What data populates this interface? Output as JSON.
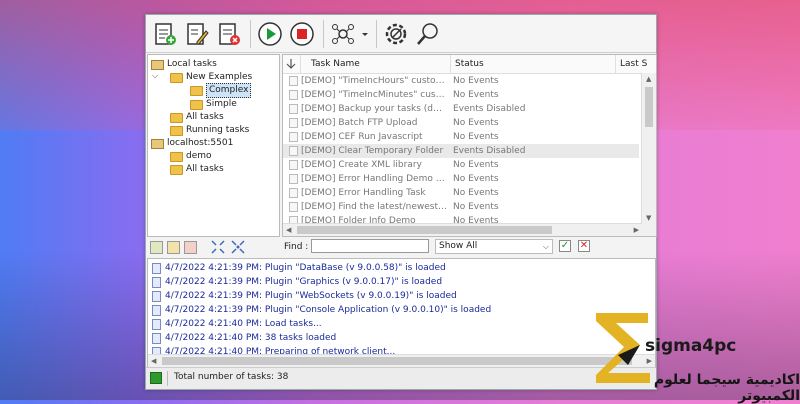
{
  "colors": {
    "accent": "#e3b324",
    "status_ok": "#2e9a2e",
    "log_text": "#1a2a9a"
  },
  "toolbar": {
    "buttons": [
      {
        "icon": "new-task-icon"
      },
      {
        "icon": "edit-task-icon"
      },
      {
        "icon": "delete-task-icon"
      },
      {
        "icon": "run-icon"
      },
      {
        "icon": "stop-icon"
      },
      {
        "icon": "network-icon"
      },
      {
        "icon": "settings-icon"
      },
      {
        "icon": "search-icon"
      }
    ]
  },
  "tree": {
    "items": [
      {
        "label": "Local tasks",
        "icon": "server-icon"
      },
      {
        "label": "New Examples",
        "icon": "folder-icon"
      },
      {
        "label": "Complex",
        "icon": "folder-icon",
        "selected": true
      },
      {
        "label": "Simple",
        "icon": "folder-icon"
      },
      {
        "label": "All tasks",
        "icon": "folder-icon"
      },
      {
        "label": "Running tasks",
        "icon": "folder-icon"
      },
      {
        "label": "localhost:5501",
        "icon": "server-icon"
      },
      {
        "label": "demo",
        "icon": "folder-icon"
      },
      {
        "label": "All tasks",
        "icon": "folder-icon"
      }
    ]
  },
  "grid": {
    "columns": [
      "Task Name",
      "Status",
      "Last S"
    ],
    "rows": [
      {
        "name": "[DEMO] \"TimeIncHours\" custom f...",
        "status": "No Events"
      },
      {
        "name": "[DEMO] \"TimeIncMinutes\" custom ...",
        "status": "No Events"
      },
      {
        "name": "[DEMO] Backup your tasks (daily ...",
        "status": "Events Disabled"
      },
      {
        "name": "[DEMO] Batch FTP Upload",
        "status": "No Events"
      },
      {
        "name": "[DEMO] CEF Run Javascript",
        "status": "No Events"
      },
      {
        "name": "[DEMO] Clear Temporary Folder",
        "status": "Events Disabled",
        "selected": true
      },
      {
        "name": "[DEMO] Create XML library",
        "status": "No Events"
      },
      {
        "name": "[DEMO] Error Handling Demo (Se...",
        "status": "No Events"
      },
      {
        "name": "[DEMO] Error Handling Task",
        "status": "No Events"
      },
      {
        "name": "[DEMO] Find the latest/newest m...",
        "status": "No Events"
      },
      {
        "name": "[DEMO] Folder Info Demo",
        "status": "No Events"
      }
    ]
  },
  "find": {
    "label": "Find :",
    "value": "",
    "show": "Show All"
  },
  "log": {
    "lines": [
      "4/7/2022 4:21:39 PM: Plugin \"DataBase (v 9.0.0.58)\" is loaded",
      "4/7/2022 4:21:39 PM: Plugin \"Graphics (v 9.0.0.17)\" is loaded",
      "4/7/2022 4:21:39 PM: Plugin \"WebSockets (v 9.0.0.19)\" is loaded",
      "4/7/2022 4:21:39 PM: Plugin \"Console Application (v 9.0.0.10)\" is loaded",
      "4/7/2022 4:21:40 PM: Load tasks...",
      "4/7/2022 4:21:40 PM: 38 tasks loaded",
      "4/7/2022 4:21:40 PM: Preparing of network client..."
    ]
  },
  "status": {
    "text": "Total number of tasks: 38"
  },
  "brand": {
    "name": "sigma4pc",
    "tagline": "اكاديمية سيجما لعلوم الكمبيوتر"
  }
}
